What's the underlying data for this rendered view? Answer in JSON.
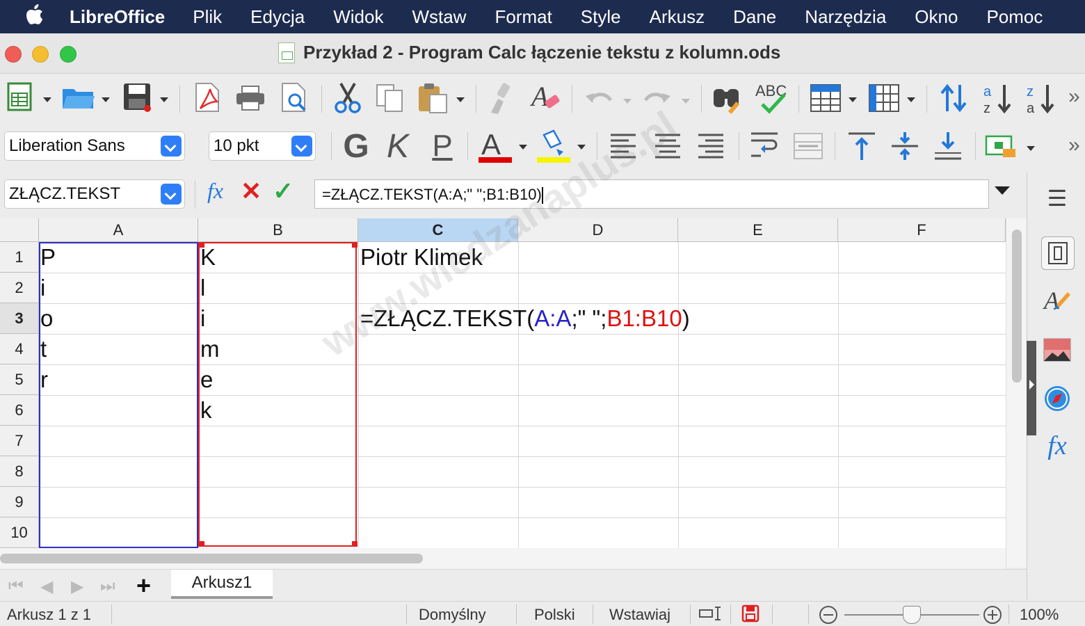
{
  "menubar": {
    "app": "LibreOffice",
    "items": [
      "Plik",
      "Edycja",
      "Widok",
      "Wstaw",
      "Format",
      "Style",
      "Arkusz",
      "Dane",
      "Narzędzia",
      "Okno",
      "Pomoc"
    ]
  },
  "window": {
    "title": "Przykład 2 - Program Calc łączenie tekstu z kolumn.ods"
  },
  "toolbar2": {
    "font_name": "Liberation Sans",
    "font_size": "10 pkt",
    "bold": "G",
    "italic": "K",
    "underline": "P",
    "font_color": "#e00000",
    "highlight_color": "#f5f500"
  },
  "formula_bar": {
    "name_box": "ZŁĄCZ.TEKST",
    "fx": "fx",
    "cancel": "✕",
    "accept": "✓",
    "content": "=ZŁĄCZ.TEKST(A:A;\" \";B1:B10)"
  },
  "sheet": {
    "columns": [
      "A",
      "B",
      "C",
      "D",
      "E",
      "F"
    ],
    "rows": [
      "1",
      "2",
      "3",
      "4",
      "5",
      "6",
      "7",
      "8",
      "9",
      "10"
    ],
    "col_a": [
      "P",
      "i",
      "o",
      "t",
      "r"
    ],
    "col_b": [
      "K",
      "l",
      "i",
      "m",
      "e",
      "k"
    ],
    "c1": "Piotr Klimek",
    "c3": {
      "prefix": "=ZŁĄCZ.TEKST(",
      "ref_a": "A:A",
      "middle": ";\" \";",
      "ref_b": "B1:B10",
      "suffix": ")"
    },
    "ref_a_color": "#2a22c8",
    "ref_b_color": "#e01010"
  },
  "tabs": {
    "add": "+",
    "sheet_name": "Arkusz1"
  },
  "status": {
    "sheet_info": "Arkusz 1 z 1",
    "page_style": "Domyślny",
    "language": "Polski",
    "insert_mode": "Wstawiaj",
    "zoom": "100%",
    "zoom_level": 0.5
  },
  "sidebar": {
    "menu": "☰",
    "fx": "fx"
  },
  "watermark": "www.wiedzanaplus.pl"
}
